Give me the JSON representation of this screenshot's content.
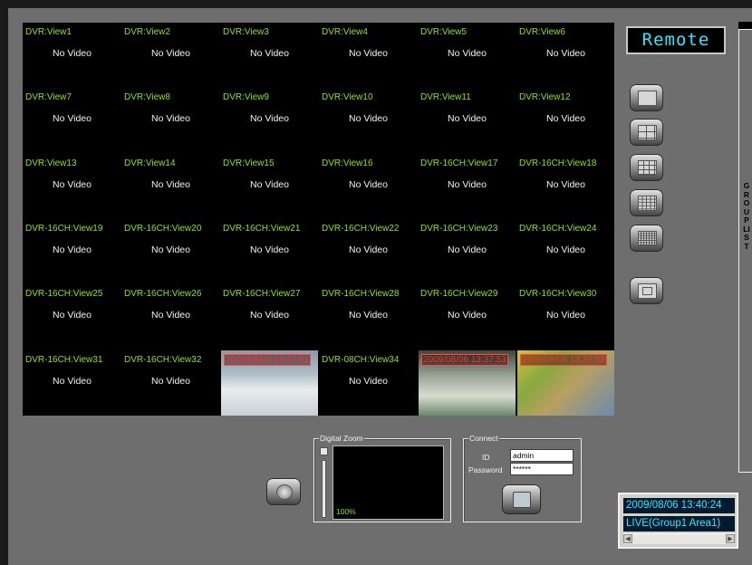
{
  "views": [
    {
      "title": "DVR:View1",
      "status": "No Video"
    },
    {
      "title": "DVR:View2",
      "status": "No Video"
    },
    {
      "title": "DVR:View3",
      "status": "No Video"
    },
    {
      "title": "DVR:View4",
      "status": "No Video"
    },
    {
      "title": "DVR:View5",
      "status": "No Video"
    },
    {
      "title": "DVR:View6",
      "status": "No Video"
    },
    {
      "title": "DVR:View7",
      "status": "No Video"
    },
    {
      "title": "DVR:View8",
      "status": "No Video"
    },
    {
      "title": "DVR:View9",
      "status": "No Video"
    },
    {
      "title": "DVR:View10",
      "status": "No Video"
    },
    {
      "title": "DVR:View11",
      "status": "No Video"
    },
    {
      "title": "DVR:View12",
      "status": "No Video"
    },
    {
      "title": "DVR:View13",
      "status": "No Video"
    },
    {
      "title": "DVR:View14",
      "status": "No Video"
    },
    {
      "title": "DVR:View15",
      "status": "No Video"
    },
    {
      "title": "DVR:View16",
      "status": "No Video"
    },
    {
      "title": "DVR-16CH:View17",
      "status": "No Video"
    },
    {
      "title": "DVR-16CH:View18",
      "status": "No Video"
    },
    {
      "title": "DVR-16CH:View19",
      "status": "No Video"
    },
    {
      "title": "DVR-16CH:View20",
      "status": "No Video"
    },
    {
      "title": "DVR-16CH:View21",
      "status": "No Video"
    },
    {
      "title": "DVR-16CH:View22",
      "status": "No Video"
    },
    {
      "title": "DVR-16CH:View23",
      "status": "No Video"
    },
    {
      "title": "DVR-16CH:View24",
      "status": "No Video"
    },
    {
      "title": "DVR-16CH:View25",
      "status": "No Video"
    },
    {
      "title": "DVR-16CH:View26",
      "status": "No Video"
    },
    {
      "title": "DVR-16CH:View27",
      "status": "No Video"
    },
    {
      "title": "DVR-16CH:View28",
      "status": "No Video"
    },
    {
      "title": "DVR-16CH:View29",
      "status": "No Video"
    },
    {
      "title": "DVR-16CH:View30",
      "status": "No Video"
    },
    {
      "title": "DVR-16CH:View31",
      "status": "No Video"
    },
    {
      "title": "DVR-16CH:View32",
      "status": "No Video"
    },
    {
      "title": "",
      "status": "",
      "live": true,
      "timestamp": "2009/08/06 13:37:51",
      "feed": "cam1"
    },
    {
      "title": "DVR-08CH:View34",
      "status": "No Video"
    },
    {
      "title": "",
      "status": "",
      "live": true,
      "timestamp": "2009/08/06 13:37:53",
      "feed": "cam2"
    },
    {
      "title": "",
      "status": "",
      "live": true,
      "timestamp": "2009/08/06 13:37:52",
      "feed": "cam3"
    }
  ],
  "remote_button": "Remote",
  "group_list_label": "GROUP LIST",
  "layout_buttons": [
    "layout-1x1",
    "layout-2x2",
    "layout-3x3",
    "layout-4x4",
    "layout-6x6",
    "layout-sequence"
  ],
  "digital_zoom": {
    "label": "Digital Zoom",
    "value": "100%",
    "level": 1.0
  },
  "connect": {
    "label": "Connect",
    "id_label": "ID",
    "password_label": "Password",
    "id_value": "admin",
    "password_value": "******"
  },
  "status": {
    "time": "2009/08/06 13:40:24",
    "mode": "LIVE(Group1 Area1)"
  },
  "colors": {
    "title_green": "#8ee21a",
    "timestamp_red": "#ff3030",
    "remote_cyan": "#32e6ff",
    "status_cyan": "#38e8ff",
    "panel_gray": "#6e6e6e"
  }
}
